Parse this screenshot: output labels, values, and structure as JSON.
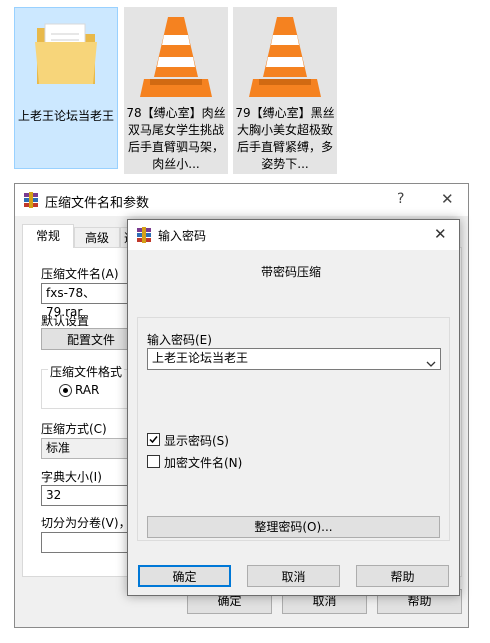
{
  "desktop": {
    "files": [
      {
        "caption": "上老王论坛当老王",
        "icon": "folder-icon"
      },
      {
        "caption": "78【缚心室】肉丝双马尾女学生挑战后手直臂驷马架，肉丝小...",
        "icon": "vlc-icon"
      },
      {
        "caption": "79【缚心室】黑丝大胸小美女超极致后手直臂紧缚，多姿势下...",
        "icon": "vlc-icon"
      }
    ]
  },
  "main_window": {
    "title": "压缩文件名和参数",
    "help_glyph": "?",
    "close_glyph": "✕",
    "tabs": [
      "常规",
      "高级",
      "选"
    ],
    "archive_name_label": "压缩文件名(A)",
    "archive_name_value": "fxs-78、79.rar",
    "default_settings_label": "默认设置",
    "profiles_button": "配置文件",
    "format_group_label": "压缩文件格式",
    "format_rar": "RAR",
    "method_label": "压缩方式(C)",
    "method_value": "标准",
    "dict_label": "字典大小(I)",
    "dict_value": "32",
    "split_label": "切分为分卷(V)，大",
    "ok": "确定",
    "cancel": "取消",
    "help": "帮助"
  },
  "password_dialog": {
    "title": "输入密码",
    "close_glyph": "✕",
    "heading": "带密码压缩",
    "enter_password_label": "输入密码(E)",
    "password_value": "上老王论坛当老王",
    "show_password_label": "显示密码(S)",
    "show_password_checked": true,
    "encrypt_names_label": "加密文件名(N)",
    "encrypt_names_checked": false,
    "organize_button": "整理密码(O)...",
    "ok": "确定",
    "cancel": "取消",
    "help": "帮助"
  }
}
